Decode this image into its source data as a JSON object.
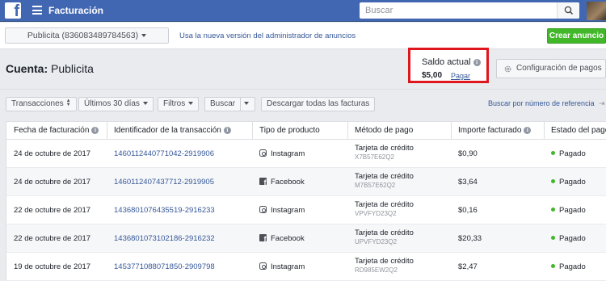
{
  "topbar": {
    "logo_letter": "f",
    "title": "Facturación",
    "search_placeholder": "Buscar"
  },
  "subbar": {
    "account_selector": "Publicita (836083489784563)",
    "new_version_link": "Usa la nueva versión del administrador de anuncios",
    "create_ad_button": "Crear anuncio"
  },
  "account": {
    "label": "Cuenta:",
    "name": "Publicita"
  },
  "balance": {
    "label": "Saldo actual",
    "value": "$5,00",
    "pay_link": "Pagar"
  },
  "payment_settings_button": "Configuración de pagos",
  "filters": {
    "transactions": "Transacciones",
    "period": "Últimos 30 días",
    "filters": "Filtros",
    "search": "Buscar",
    "download_all": "Descargar todas las facturas",
    "search_by_reference": "Buscar por número de referencia"
  },
  "table": {
    "headers": {
      "date": "Fecha de facturación",
      "transaction_id": "Identificador de la transacción",
      "product_type": "Tipo de producto",
      "payment_method": "Método de pago",
      "amount": "Importe facturado",
      "status": "Estado del pago"
    },
    "rows": [
      {
        "date": "24 de octubre de 2017",
        "transaction_id": "1460112440771042-2919906",
        "product": "Instagram",
        "product_icon": "instagram-icon",
        "method": "Tarjeta de crédito",
        "method_ref": "X7B57E62Q2",
        "amount": "$0,90",
        "status": "Pagado"
      },
      {
        "date": "24 de octubre de 2017",
        "transaction_id": "1460112407437712-2919905",
        "product": "Facebook",
        "product_icon": "facebook-icon",
        "method": "Tarjeta de crédito",
        "method_ref": "M7B57E62Q2",
        "amount": "$3,64",
        "status": "Pagado"
      },
      {
        "date": "22 de octubre de 2017",
        "transaction_id": "1436801076435519-2916233",
        "product": "Instagram",
        "product_icon": "instagram-icon",
        "method": "Tarjeta de crédito",
        "method_ref": "VPVFYD23Q2",
        "amount": "$0,16",
        "status": "Pagado"
      },
      {
        "date": "22 de octubre de 2017",
        "transaction_id": "1436801073102186-2916232",
        "product": "Facebook",
        "product_icon": "facebook-icon",
        "method": "Tarjeta de crédito",
        "method_ref": "UPVFYD23Q2",
        "amount": "$20,33",
        "status": "Pagado"
      },
      {
        "date": "19 de octubre de 2017",
        "transaction_id": "1453771088071850-2909798",
        "product": "Instagram",
        "product_icon": "instagram-icon",
        "method": "Tarjeta de crédito",
        "method_ref": "RD985EW2Q2",
        "amount": "$2,47",
        "status": "Pagado"
      }
    ]
  },
  "colors": {
    "topbar": "#4267b2",
    "link": "#365899",
    "create_button": "#42b72a",
    "highlight_box": "#e0161f",
    "paid_dot": "#42b72a"
  }
}
